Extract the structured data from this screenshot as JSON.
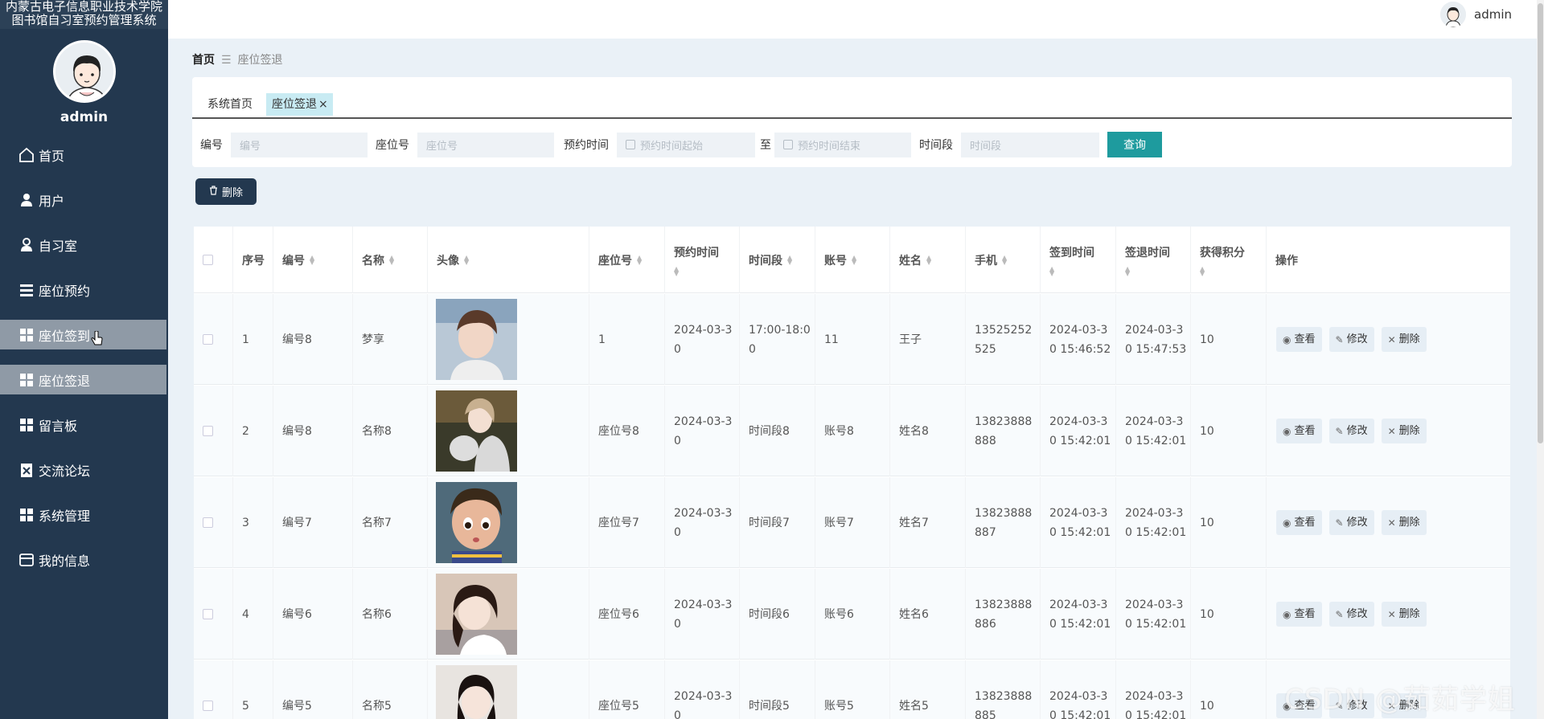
{
  "sidebar": {
    "title_line1": "内蒙古电子信息职业技术学院",
    "title_line2": "图书馆自习室预约管理系统",
    "username": "admin",
    "items": [
      {
        "label": "首页",
        "icon": "home-icon"
      },
      {
        "label": "用户",
        "icon": "user-icon"
      },
      {
        "label": "自习室",
        "icon": "person-icon"
      },
      {
        "label": "座位预约",
        "icon": "list-icon"
      },
      {
        "label": "座位签到",
        "icon": "grid-icon"
      },
      {
        "label": "座位签退",
        "icon": "grid-icon"
      },
      {
        "label": "留言板",
        "icon": "grid-icon"
      },
      {
        "label": "交流论坛",
        "icon": "clipboard-icon"
      },
      {
        "label": "系统管理",
        "icon": "grid-icon"
      },
      {
        "label": "我的信息",
        "icon": "card-icon"
      }
    ]
  },
  "topbar": {
    "username": "admin"
  },
  "breadcrumb": {
    "home": "首页",
    "current": "座位签退"
  },
  "tabs": [
    {
      "label": "系统首页"
    },
    {
      "label": "座位签退"
    }
  ],
  "filters": {
    "bianhao_label": "编号",
    "bianhao_placeholder": "编号",
    "zuowei_label": "座位号",
    "zuowei_placeholder": "座位号",
    "yuyue_label": "预约时间",
    "start_placeholder": "预约时间起始",
    "to_label": "至",
    "end_placeholder": "预约时间结束",
    "shijianduan_label": "时间段",
    "shijianduan_placeholder": "时间段",
    "query_label": "查询"
  },
  "toolbar": {
    "delete_label": "删除"
  },
  "table": {
    "headers": [
      "序号",
      "编号",
      "名称",
      "头像",
      "座位号",
      "预约时间",
      "时间段",
      "账号",
      "姓名",
      "手机",
      "签到时间",
      "签退时间",
      "获得积分",
      "操作"
    ],
    "rows": [
      {
        "idx": "1",
        "bianhao": "编号8",
        "mingcheng": "梦享",
        "zuowei": "1",
        "yuyue": "2024-03-3\n0",
        "shijianduan": "17:00-18:0\n0",
        "zhanghao": "11",
        "xingming": "王子",
        "shouji": "13525252\n525",
        "qiandao": "2024-03-3\n0 15:46:52",
        "qiantui": "2024-03-3\n0 15:47:53",
        "jifen": "10"
      },
      {
        "idx": "2",
        "bianhao": "编号8",
        "mingcheng": "名称8",
        "zuowei": "座位号8",
        "yuyue": "2024-03-3\n0",
        "shijianduan": "时间段8",
        "zhanghao": "账号8",
        "xingming": "姓名8",
        "shouji": "13823888\n888",
        "qiandao": "2024-03-3\n0 15:42:01",
        "qiantui": "2024-03-3\n0 15:42:01",
        "jifen": "10"
      },
      {
        "idx": "3",
        "bianhao": "编号7",
        "mingcheng": "名称7",
        "zuowei": "座位号7",
        "yuyue": "2024-03-3\n0",
        "shijianduan": "时间段7",
        "zhanghao": "账号7",
        "xingming": "姓名7",
        "shouji": "13823888\n887",
        "qiandao": "2024-03-3\n0 15:42:01",
        "qiantui": "2024-03-3\n0 15:42:01",
        "jifen": "10"
      },
      {
        "idx": "4",
        "bianhao": "编号6",
        "mingcheng": "名称6",
        "zuowei": "座位号6",
        "yuyue": "2024-03-3\n0",
        "shijianduan": "时间段6",
        "zhanghao": "账号6",
        "xingming": "姓名6",
        "shouji": "13823888\n886",
        "qiandao": "2024-03-3\n0 15:42:01",
        "qiantui": "2024-03-3\n0 15:42:01",
        "jifen": "10"
      },
      {
        "idx": "5",
        "bianhao": "编号5",
        "mingcheng": "名称5",
        "zuowei": "座位号5",
        "yuyue": "2024-03-3\n0",
        "shijianduan": "时间段5",
        "zhanghao": "账号5",
        "xingming": "姓名5",
        "shouji": "13823888\n885",
        "qiandao": "2024-03-3\n0 15:42:01",
        "qiantui": "2024-03-3\n0 15:42:01",
        "jifen": "10"
      }
    ],
    "ops": {
      "view": "查看",
      "edit": "修改",
      "delete": "删除"
    }
  },
  "watermark": "CSDN @茹茹学姐",
  "colors": {
    "sidebar_bg": "#23384f",
    "accent": "#1e9b9e",
    "active_item": "#8f9aa6"
  }
}
